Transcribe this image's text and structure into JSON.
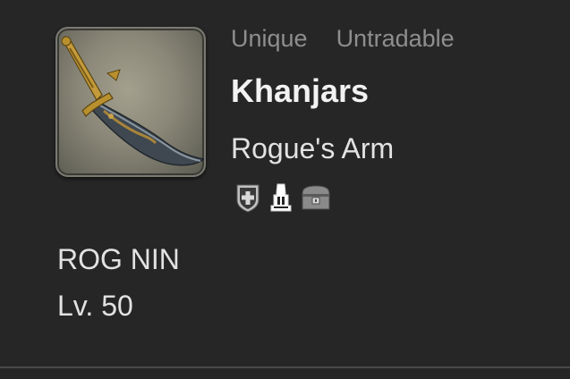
{
  "item": {
    "tags": [
      "Unique",
      "Untradable"
    ],
    "name": "Khanjars",
    "category": "Rogue's Arm",
    "jobs": "ROG NIN",
    "level": "Lv. 50",
    "icon": "khanjar-weapon-icon"
  },
  "status_icons": [
    "repair-icon",
    "glamour-dresser-icon",
    "armoire-icon"
  ]
}
